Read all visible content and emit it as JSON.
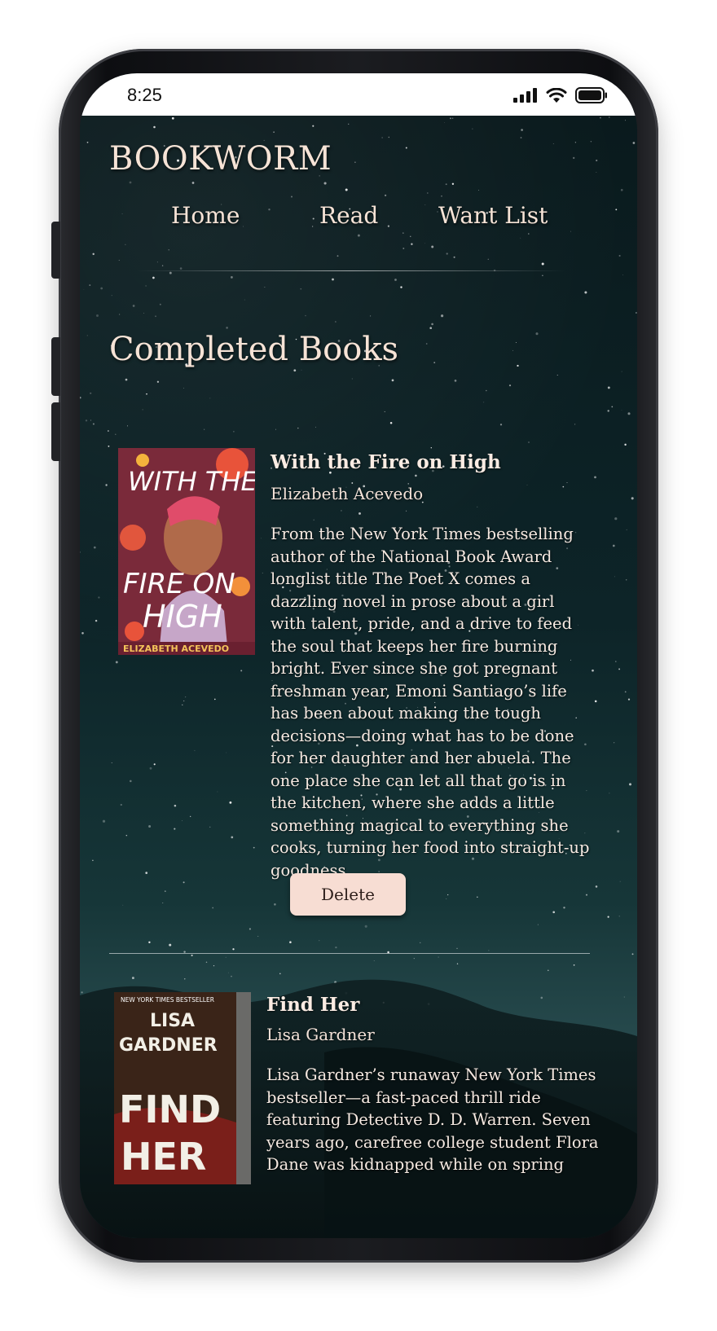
{
  "status_bar": {
    "time": "8:25",
    "icons": [
      "signal-icon",
      "wifi-icon",
      "battery-icon"
    ]
  },
  "app": {
    "brand": "BOOKWORM",
    "nav": {
      "home": "Home",
      "read": "Read",
      "want_list": "Want List"
    },
    "section_title": "Completed Books"
  },
  "books": [
    {
      "title": "With the Fire on High",
      "author": "Elizabeth Acevedo",
      "description": "From the New York Times bestselling author of the National Book Award longlist title The Poet X comes a dazzling novel in prose about a girl with talent, pride, and a drive to feed the soul that keeps her fire burning bright. Ever since she got pregnant freshman year, Emoni Santiago’s life has been about making the tough decisions—doing what has to be done for her daughter and her abuela. The one place she can let all that go is in the kitchen, where she adds a little something magical to everything she cooks, turning her food into straight-up goodness.",
      "delete_label": "Delete",
      "cover": {
        "line1": "WITH THE",
        "line2": "FIRE ON",
        "line3": "HIGH",
        "author": "ELIZABETH ACEVEDO",
        "bg": "#7a2a3a"
      }
    },
    {
      "title": "Find Her",
      "author": "Lisa Gardner",
      "description": "Lisa Gardner’s runaway New York Times bestseller—a fast-paced thrill ride featuring Detective D. D. Warren. Seven years ago, carefree college student Flora Dane was kidnapped while on spring",
      "cover": {
        "top_label": "NEW YORK TIMES BESTSELLER",
        "author_first": "LISA",
        "author_last": "GARDNER",
        "title1": "FIND",
        "title2": "HER",
        "bg": "#1a1410"
      }
    }
  ],
  "colors": {
    "text_cream": "#f6e3d6",
    "button_bg": "#f7ddd3",
    "sky_dark": "#0a1a1d"
  }
}
